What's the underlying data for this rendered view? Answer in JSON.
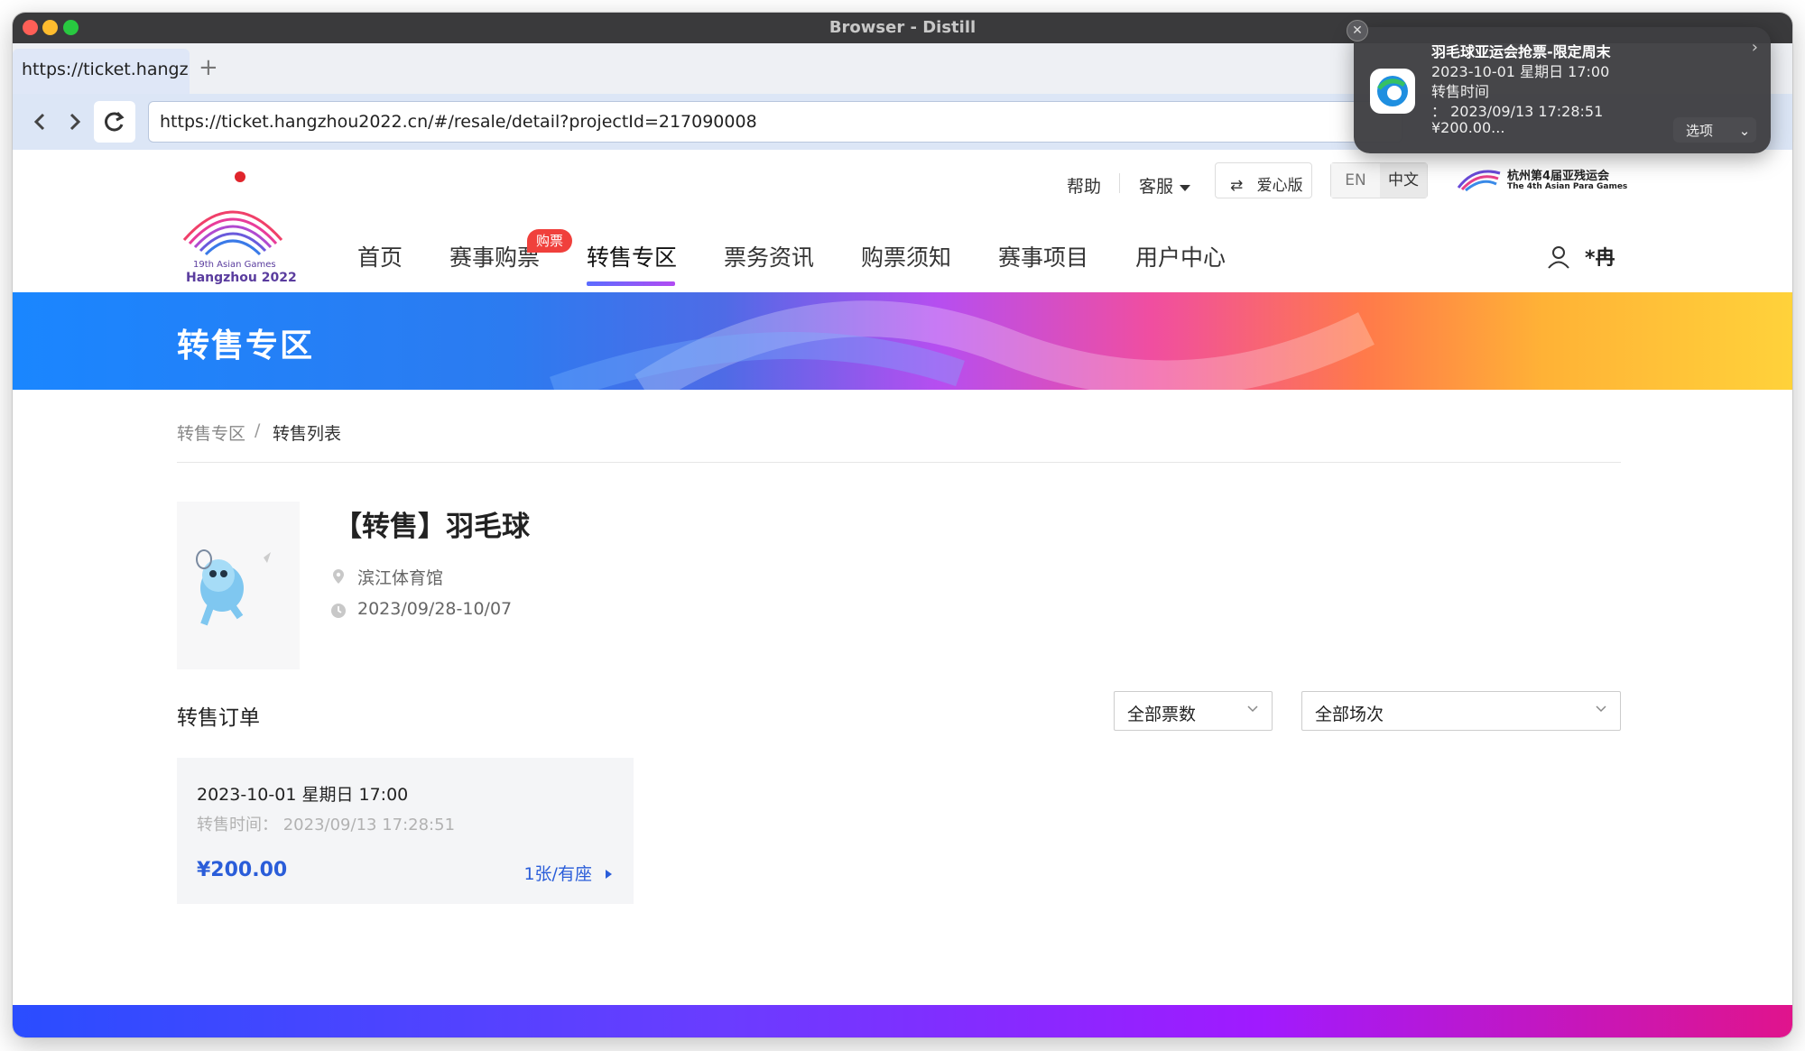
{
  "window": {
    "title": "Browser - Distill"
  },
  "browser": {
    "tab_label": "https://ticket.hangz...",
    "new_tab": "+",
    "url": "https://ticket.hangzhou2022.cn/#/resale/detail?projectId=217090008"
  },
  "header": {
    "logo_line1": "19th Asian Games",
    "logo_line2": "Hangzhou 2022",
    "help": "帮助",
    "service": "客服",
    "care_mode": "爱心版",
    "lang_en": "EN",
    "lang_zh": "中文",
    "para_line1": "杭州第4届亚残运会",
    "para_line2": "The 4th Asian Para Games",
    "nav": [
      {
        "label": "首页"
      },
      {
        "label": "赛事购票"
      },
      {
        "label": "转售专区"
      },
      {
        "label": "票务资讯"
      },
      {
        "label": "购票须知"
      },
      {
        "label": "赛事项目"
      },
      {
        "label": "用户中心"
      }
    ],
    "badge": "购票",
    "user_name": "*冉"
  },
  "banner": {
    "title": "转售专区"
  },
  "breadcrumb": {
    "root": "转售专区",
    "separator": "/",
    "current": "转售列表"
  },
  "event": {
    "title": "【转售】羽毛球",
    "venue": "滨江体育馆",
    "dates": "2023/09/28-10/07"
  },
  "orders": {
    "section_title": "转售订单",
    "filter_tickets": "全部票数",
    "filter_sessions": "全部场次",
    "items": [
      {
        "datetime": "2023-10-01 星期日 17:00",
        "resale_time": "转售时间： 2023/09/13 17:28:51",
        "price": "¥200.00",
        "qty": "1张/有座"
      }
    ]
  },
  "notification": {
    "line1": "羽毛球亚运会抢票-限定周末",
    "line2": "2023-10-01 星期日 17:00",
    "line3": "转售时间",
    "line4": "： 2023/09/13 17:28:51",
    "line5": "¥200.00...",
    "options": "选项"
  }
}
